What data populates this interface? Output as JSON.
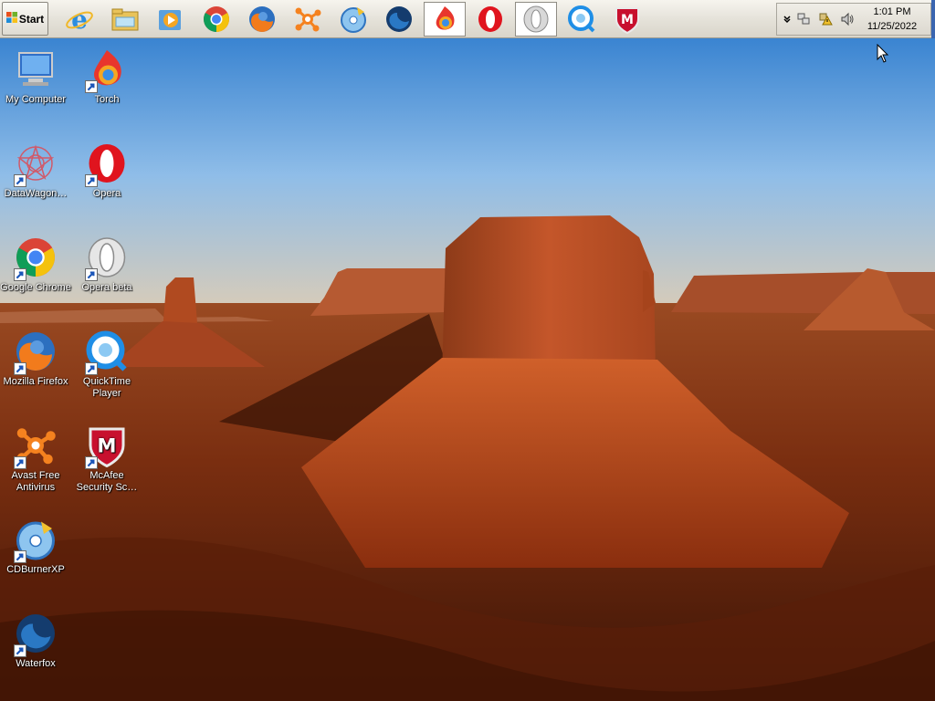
{
  "taskbar": {
    "start_label": "Start",
    "quick_launch": [
      {
        "name": "internet-explorer",
        "icon": "ie-icon"
      },
      {
        "name": "windows-explorer",
        "icon": "folder-icon"
      },
      {
        "name": "media-player",
        "icon": "media-player-icon"
      },
      {
        "name": "google-chrome",
        "icon": "chrome-icon"
      },
      {
        "name": "mozilla-firefox",
        "icon": "firefox-icon"
      },
      {
        "name": "avast",
        "icon": "avast-icon"
      },
      {
        "name": "cdburnerxp",
        "icon": "cdburner-icon"
      },
      {
        "name": "waterfox",
        "icon": "waterfox-icon"
      },
      {
        "name": "torch",
        "icon": "torch-icon",
        "pressed": true
      },
      {
        "name": "opera",
        "icon": "opera-icon"
      },
      {
        "name": "opera-beta",
        "icon": "opera-beta-icon",
        "pressed": true
      },
      {
        "name": "quicktime",
        "icon": "quicktime-icon"
      },
      {
        "name": "mcafee",
        "icon": "mcafee-icon"
      }
    ],
    "tray": {
      "time": "1:01 PM",
      "date": "11/25/2022",
      "icons": [
        "chevron-down-icon",
        "network-icon",
        "security-warning-icon",
        "volume-icon"
      ]
    }
  },
  "desktop": {
    "icons": [
      {
        "label": "My Computer",
        "icon": "computer-icon",
        "shortcut": false
      },
      {
        "label": "Torch",
        "icon": "torch-icon",
        "shortcut": true
      },
      {
        "label": "DataWagon…",
        "icon": "datawagon-icon",
        "shortcut": true
      },
      {
        "label": "Opera",
        "icon": "opera-icon",
        "shortcut": true
      },
      {
        "label": "Google Chrome",
        "icon": "chrome-icon",
        "shortcut": true
      },
      {
        "label": "Opera beta",
        "icon": "opera-beta-icon",
        "shortcut": true
      },
      {
        "label": "Mozilla Firefox",
        "icon": "firefox-icon",
        "shortcut": true
      },
      {
        "label": "QuickTime Player",
        "icon": "quicktime-icon",
        "shortcut": true
      },
      {
        "label": "Avast Free Antivirus",
        "icon": "avast-icon",
        "shortcut": true
      },
      {
        "label": "McAfee Security Sc…",
        "icon": "mcafee-icon",
        "shortcut": true
      },
      {
        "label": "CDBurnerXP",
        "icon": "cdburner-icon",
        "shortcut": true
      },
      {
        "label": "Waterfox",
        "icon": "waterfox-icon",
        "shortcut": true
      }
    ]
  },
  "colors": {
    "taskbar_bg": "#e4e1d8",
    "sky": "#6aa6e0",
    "rock": "#b5471c"
  }
}
